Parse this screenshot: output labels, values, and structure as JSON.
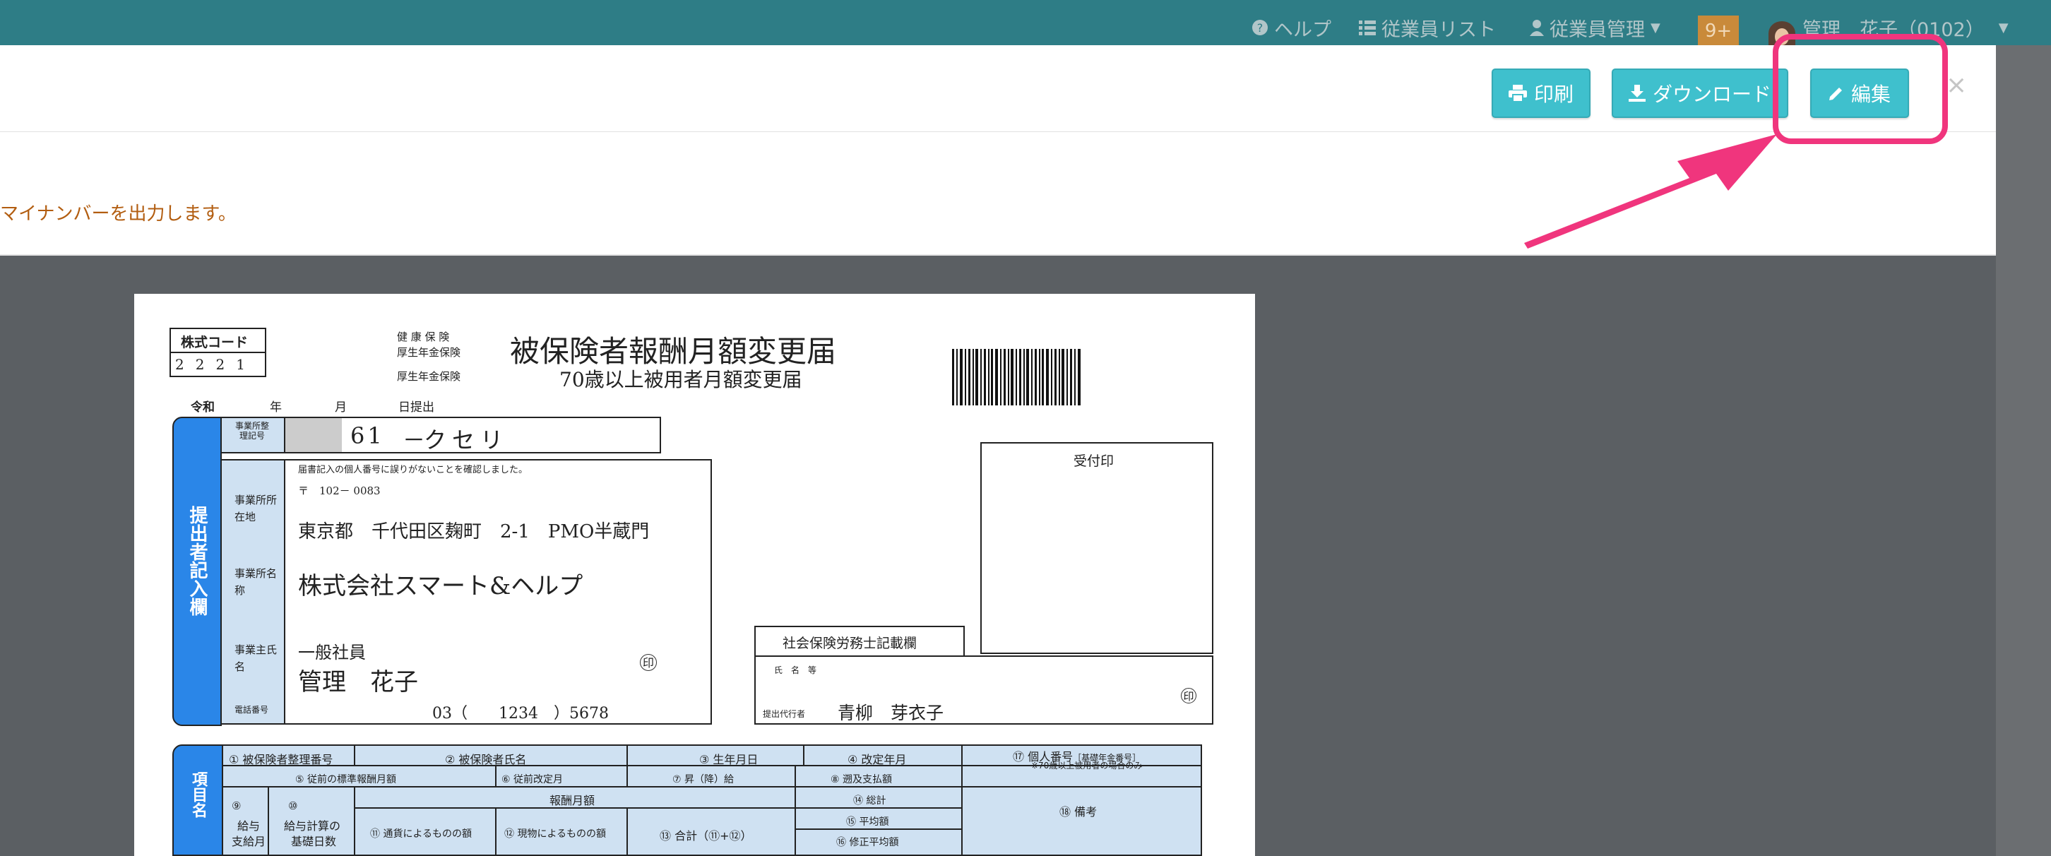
{
  "topbar": {
    "help": "ヘルプ",
    "employee_list": "従業員リスト",
    "employee_manage": "従業員管理",
    "notifications": "9+",
    "user": "管理　花子（0102）"
  },
  "toolbar": {
    "print": "印刷",
    "download": "ダウンロード",
    "edit": "編集",
    "close": "×"
  },
  "notice": "マイナンバーを出力します。",
  "colors": {
    "topbar": "#2e7d86",
    "button": "#3fc0cd",
    "highlight": "#f0357d",
    "notice": "#b25d10"
  },
  "form": {
    "form_code_label": "株式コード",
    "form_code": [
      "2",
      "2",
      "2",
      "1"
    ],
    "insurance_lines": [
      "健 康 保 険",
      "厚生年金保険",
      "厚生年金保険"
    ],
    "title": "被保険者報酬月額変更届",
    "subtitle": "70歳以上被用者月額変更届",
    "era": "令和",
    "year": "年",
    "month": "月",
    "day_submit": "日提出",
    "office_number_label": "事業所整理記号",
    "office_number": "61",
    "office_dash": "－",
    "office_code": "クセリ",
    "side_label": "提出者記入欄",
    "confirm_note": "届書記入の個人番号に誤りがないことを確認しました。",
    "postal": "〒　102－ 0083",
    "addr_label": "事業所所在地",
    "address": "東京都　千代田区麹町　2-1　PMO半蔵門",
    "name_label": "事業所名称",
    "company": "株式会社スマート&ヘルプ",
    "owner_label": "事業主氏名",
    "owner_title": "一般社員",
    "owner_name": "管理　花子",
    "seal": "印",
    "phone_label": "電話番号",
    "phone": "03（　　1234　）5678",
    "receipt": "受付印",
    "sharoushi_box": "社会保険労務士記載欄",
    "name_etc": "氏　名　等",
    "agent_label": "提出代行者",
    "agent": "青柳　芽衣子",
    "items_side": "項目名",
    "cols": {
      "c1": "①  被保険者整理番号",
      "c2": "②  被保険者氏名",
      "c3": "③  生年月日",
      "c4": "④  改定年月",
      "c17": "⑰  個人番号",
      "c17_sub": "［基礎年金番号］",
      "c17_note": "※70歳以上被用者の場合のみ",
      "c5": "⑤ 従前の標準報酬月額",
      "c6": "⑥ 従前改定月",
      "c7": "⑦  昇（降）給",
      "c8": "⑧  遡及支払額",
      "c9a": "⑨",
      "c9b": "給与",
      "c9c": "支給月",
      "c10a": "⑩",
      "c10b": "給与計算の",
      "c10c": "基礎日数",
      "pay": "報酬月額",
      "c11": "⑪ 通貨によるものの額",
      "c12": "⑫ 現物によるものの額",
      "c13": "⑬  合計（⑪+⑫）",
      "c14": "⑭  総計",
      "c15": "⑮  平均額",
      "c16": "⑯  修正平均額",
      "c18": "⑱  備考"
    }
  }
}
